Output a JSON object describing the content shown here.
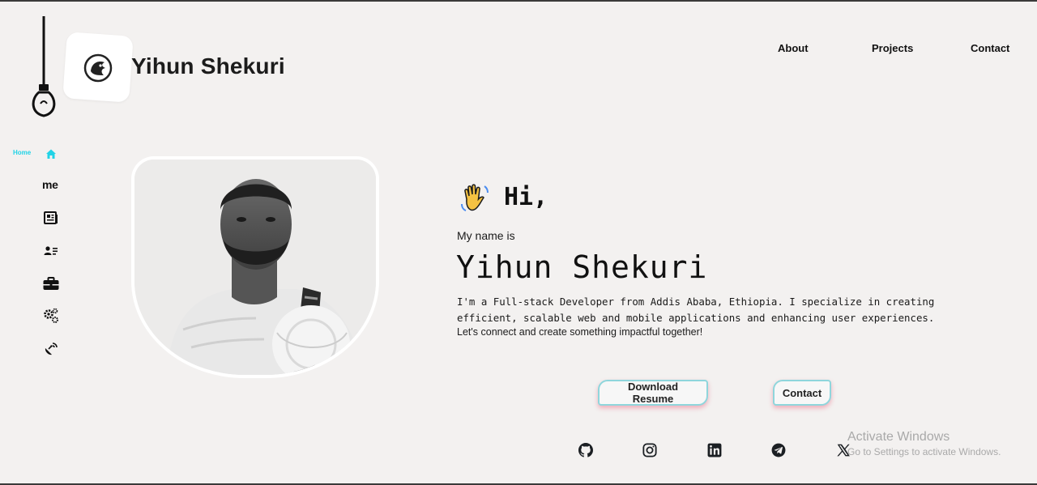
{
  "header": {
    "title": "Yihun Shekuri",
    "icons": {
      "lamp": "hanging-lightbulb-icon",
      "logo": "lion-logo-icon"
    }
  },
  "nav": {
    "about": "About",
    "projects": "Projects",
    "contact": "Contact"
  },
  "sidebar": {
    "home_label": "Home",
    "me_label": "me",
    "accent": "#22d3e6",
    "items": [
      {
        "icon": "home-icon",
        "active": true
      },
      {
        "icon": "me-text"
      },
      {
        "icon": "newspaper-icon"
      },
      {
        "icon": "id-card-icon"
      },
      {
        "icon": "briefcase-icon"
      },
      {
        "icon": "gears-icon"
      },
      {
        "icon": "satellite-dish-icon"
      }
    ]
  },
  "hero": {
    "greeting": "Hi,",
    "greeting_icon": "waving-hand-icon",
    "intro": "My name is",
    "name": "Yihun Shekuri",
    "bio_mono": "I'm a Full-stack Developer from Addis Ababa, Ethiopia. I specialize in creating efficient, scalable web and mobile applications and enhancing user experiences.",
    "bio_sans": "Let's connect and create something impactful together!"
  },
  "buttons": {
    "resume": "Download Resume",
    "contact": "Contact"
  },
  "social": [
    "github-icon",
    "instagram-icon",
    "linkedin-icon",
    "telegram-icon",
    "x-icon"
  ],
  "watermark": {
    "title": "Activate Windows",
    "subtitle": "Go to Settings to activate Windows."
  }
}
